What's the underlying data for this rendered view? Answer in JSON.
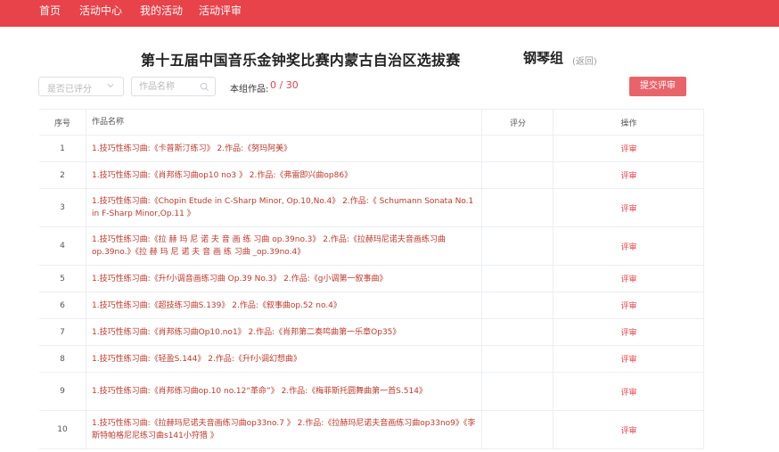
{
  "nav": {
    "items": [
      "首页",
      "活动中心",
      "我的活动",
      "活动评审"
    ]
  },
  "header": {
    "title": "第十五届中国音乐金钟奖比赛内蒙古自治区选拔赛",
    "group": "钢琴组",
    "back": "(返回)"
  },
  "filters": {
    "score_placeholder": "是否已评分",
    "name_placeholder": "作品名称",
    "count_label": "本组作品:",
    "count_value": "0 / 30",
    "submit": "提交评审"
  },
  "table": {
    "headers": {
      "no": "序号",
      "name": "作品名称",
      "score": "评分",
      "op": "操作"
    },
    "rows": [
      {
        "no": "1",
        "name": "1.技巧性练习曲:《卡普斯汀练习》 2.作品:《努玛阿美》",
        "op": "评审"
      },
      {
        "no": "2",
        "name": "1.技巧性练习曲:《肖邦练习曲op10 no3 》 2.作品:《弗雷即兴曲op86》",
        "op": "评审"
      },
      {
        "no": "3",
        "name": "1.技巧性练习曲:《Chopin Etude in C-Sharp Minor, Op.10,No.4》 2.作品:《 Schumann Sonata No.1 in F-Sharp Minor,Op.11 》",
        "op": "评审"
      },
      {
        "no": "4",
        "name": "1.技巧性练习曲:《拉 赫 玛 尼 诺 夫 音 画 练 习曲 op.39no.3》 2.作品:《拉赫玛尼诺夫音画练习曲 op.39no.》《拉 赫 玛 尼 诺 夫 音 画 练 习曲 _op.39no.4》",
        "op": "评审"
      },
      {
        "no": "5",
        "name": "1.技巧性练习曲:《升f小调音画练习曲 Op.39 No.3》 2.作品:《g小调第一叙事曲》",
        "op": "评审"
      },
      {
        "no": "6",
        "name": "1.技巧性练习曲:《超技练习曲S.139》 2.作品:《叙事曲op.52 no.4》",
        "op": "评审"
      },
      {
        "no": "7",
        "name": "1.技巧性练习曲:《肖邦练习曲Op10.no1》 2.作品:《肖邦第二奏鸣曲第一乐章Op35》",
        "op": "评审"
      },
      {
        "no": "8",
        "name": "1.技巧性练习曲:《轻盈S.144》 2.作品:《升f小调幻想曲》",
        "op": "评审"
      },
      {
        "no": "9",
        "name": "1.技巧性练习曲:《肖邦练习曲op.10 no.12“革命”》 2.作品:《梅菲斯托圆舞曲第一首S.514》",
        "op": "评审"
      },
      {
        "no": "10",
        "name": "1.技巧性练习曲:《拉赫玛尼诺夫音画练习曲op33no.7 》 2.作品:《拉赫玛尼诺夫音画练习曲op33no9》《李斯特帕格尼尼练习曲s141小狩猎 》",
        "op": "评审"
      }
    ]
  },
  "colors": {
    "brand": "#e8424a",
    "button": "#e8646a",
    "link": "#c0392b"
  },
  "icons": [
    "chevron-down-icon",
    "search-icon"
  ]
}
